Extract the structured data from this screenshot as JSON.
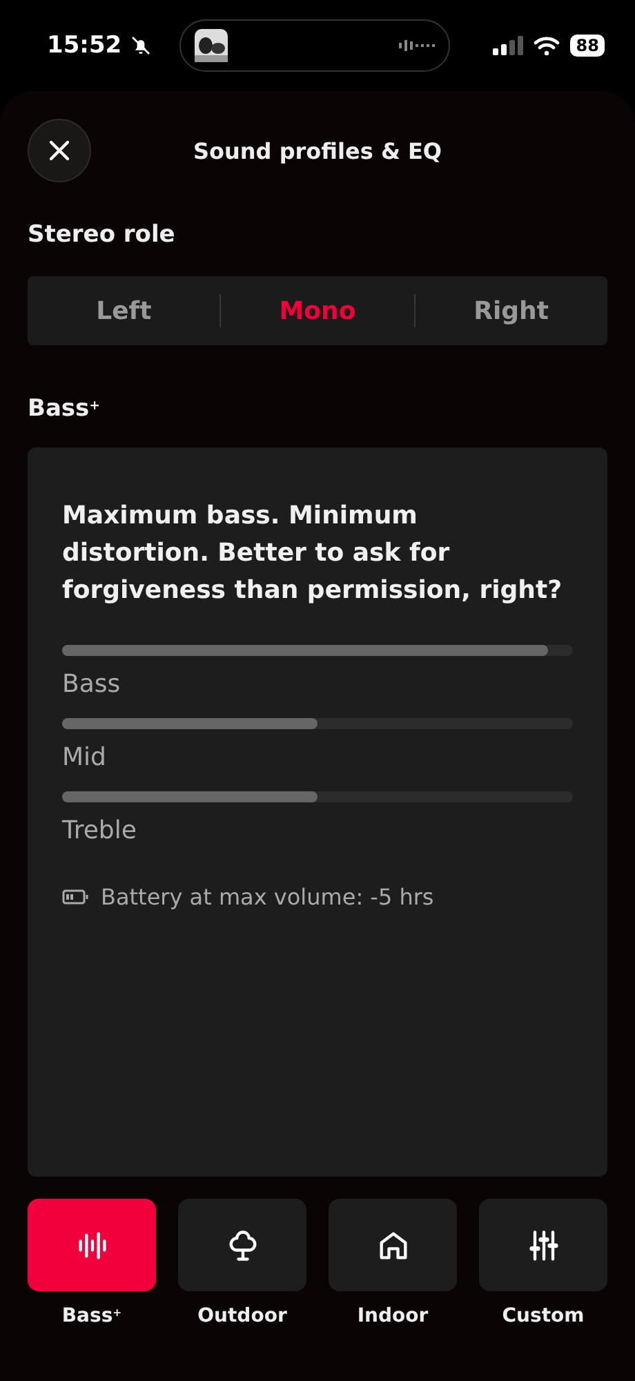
{
  "status_bar": {
    "time": "15:52",
    "battery": "88"
  },
  "header": {
    "title": "Sound profiles & EQ"
  },
  "stereo_role": {
    "title": "Stereo role",
    "options": [
      {
        "label": "Left",
        "selected": false
      },
      {
        "label": "Mono",
        "selected": true
      },
      {
        "label": "Right",
        "selected": false
      }
    ]
  },
  "profile_section": {
    "title": "Bass$^{+}$"
  },
  "card": {
    "description": "Maximum bass. Minimum distortion. Better to ask for forgiveness than permission, right?",
    "sliders": [
      {
        "label": "Bass",
        "level": 0.95
      },
      {
        "label": "Mid",
        "level": 0.5
      },
      {
        "label": "Treble",
        "level": 0.5
      }
    ],
    "battery_note": "Battery at max volume: -5 hrs"
  },
  "profiles": [
    {
      "kind": "bass",
      "label": "Bass$^{+}$",
      "selected": true
    },
    {
      "kind": "outdoor",
      "label": "Outdoor",
      "selected": false
    },
    {
      "kind": "indoor",
      "label": "Indoor",
      "selected": false
    },
    {
      "kind": "custom",
      "label": "Custom",
      "selected": false
    }
  ]
}
